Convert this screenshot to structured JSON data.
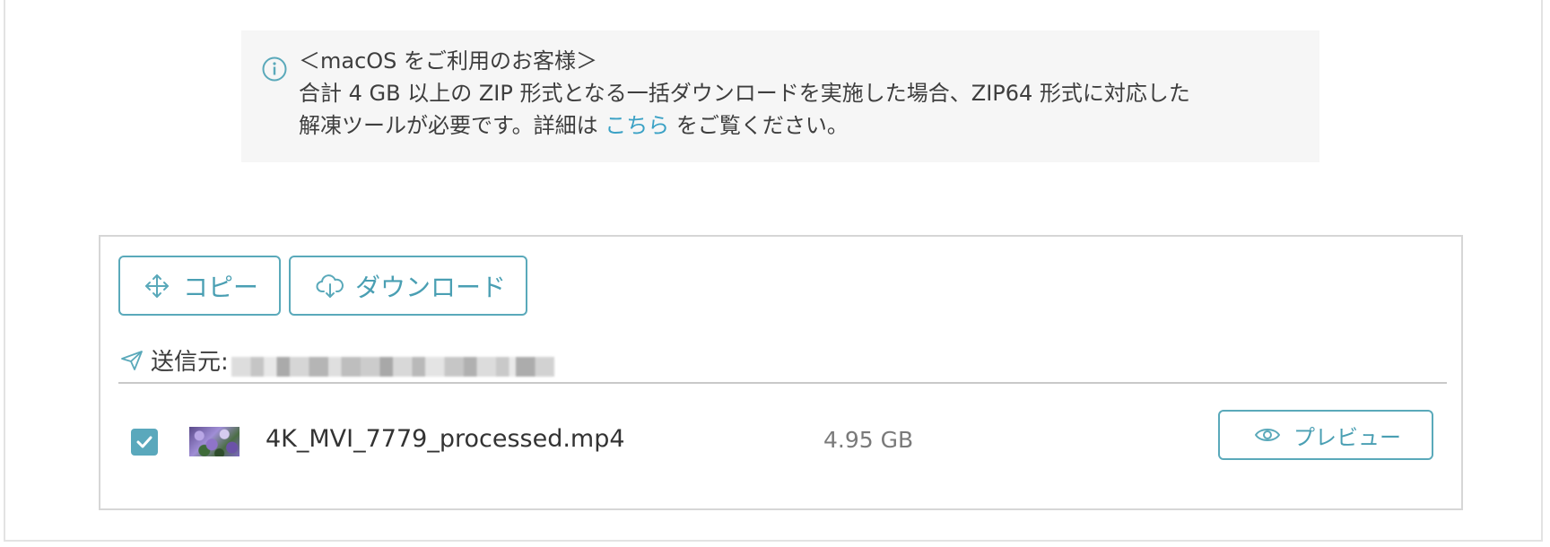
{
  "notice": {
    "title": "＜macOS をご利用のお客様＞",
    "line1": "合計 4 GB 以上の ZIP 形式となる一括ダウンロードを実施した場合、ZIP64 形式に対応した",
    "line2_before": "解凍ツールが必要です。詳細は ",
    "link_text": "こちら",
    "line2_after": " をご覧ください。",
    "icon": "info-icon"
  },
  "toolbar": {
    "copy_label": "コピー",
    "copy_icon": "move-arrows-icon",
    "download_label": "ダウンロード",
    "download_icon": "cloud-download-icon"
  },
  "sender": {
    "label": "送信元:",
    "icon": "paper-plane-icon"
  },
  "files": [
    {
      "checked": true,
      "name": "4K_MVI_7779_processed.mp4",
      "size": "4.95 GB",
      "preview_label": "プレビュー",
      "preview_icon": "eye-icon"
    }
  ],
  "colors": {
    "accent": "#5aa9ba",
    "link": "#3aa1c5",
    "notice_bg": "#f6f6f6"
  }
}
